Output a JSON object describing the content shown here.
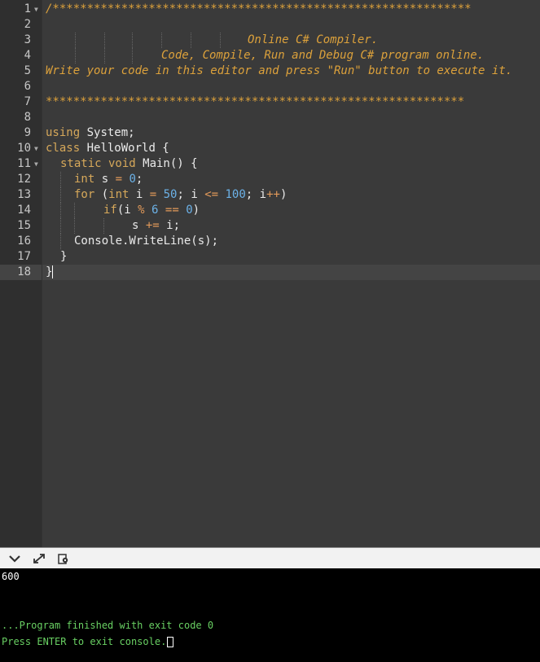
{
  "editor": {
    "lines": [
      {
        "num": "1",
        "fold": true
      },
      {
        "num": "2"
      },
      {
        "num": "3"
      },
      {
        "num": "4"
      },
      {
        "num": "5"
      },
      {
        "num": "6"
      },
      {
        "num": "7"
      },
      {
        "num": "8"
      },
      {
        "num": "9"
      },
      {
        "num": "10",
        "fold": true
      },
      {
        "num": "11",
        "fold": true
      },
      {
        "num": "12"
      },
      {
        "num": "13"
      },
      {
        "num": "14"
      },
      {
        "num": "15"
      },
      {
        "num": "16"
      },
      {
        "num": "17"
      },
      {
        "num": "18"
      }
    ],
    "text": {
      "l1": "/*************************************************************",
      "l3": "Online C# Compiler.",
      "l4": "Code, Compile, Run and Debug C# program online.",
      "l5": "Write your code in this editor and press \"Run\" button to execute it.",
      "l7": "*************************************************************",
      "l9_kw": "using",
      "l9_rest": " System;",
      "l10_kw": "class",
      "l10_rest": " HelloWorld {",
      "l11_kw": "static void",
      "l11_rest": " Main() {",
      "l12_kw": "int",
      "l12_a": " s ",
      "l12_op": "=",
      "l12_b": " ",
      "l12_num": "0",
      "l12_end": ";",
      "l13_kw": "for",
      "l13_a": " (",
      "l13_kw2": "int",
      "l13_b": " i ",
      "l13_op1": "=",
      "l13_c": " ",
      "l13_n1": "50",
      "l13_d": "; i ",
      "l13_op2": "<=",
      "l13_e": " ",
      "l13_n2": "100",
      "l13_f": "; i",
      "l13_op3": "++",
      "l13_g": ")",
      "l14_kw": "if",
      "l14_a": "(i ",
      "l14_op1": "%",
      "l14_b": " ",
      "l14_n1": "6",
      "l14_c": " ",
      "l14_op2": "==",
      "l14_d": " ",
      "l14_n2": "0",
      "l14_e": ")",
      "l15_a": "s ",
      "l15_op": "+=",
      "l15_b": " i;",
      "l16": "Console.WriteLine(s);",
      "l17": "}",
      "l18": "}"
    }
  },
  "console": {
    "output": "600",
    "finished": "...Program finished with exit code 0",
    "prompt": "Press ENTER to exit console."
  },
  "toolbar": {
    "icons": [
      "chevron-down-icon",
      "expand-icon",
      "settings-icon"
    ]
  },
  "colors": {
    "editor_bg": "#3a3a3a",
    "comment": "#dca13b",
    "keyword": "#d6a85a",
    "number": "#6cb2e8",
    "console_green": "#69d063"
  }
}
